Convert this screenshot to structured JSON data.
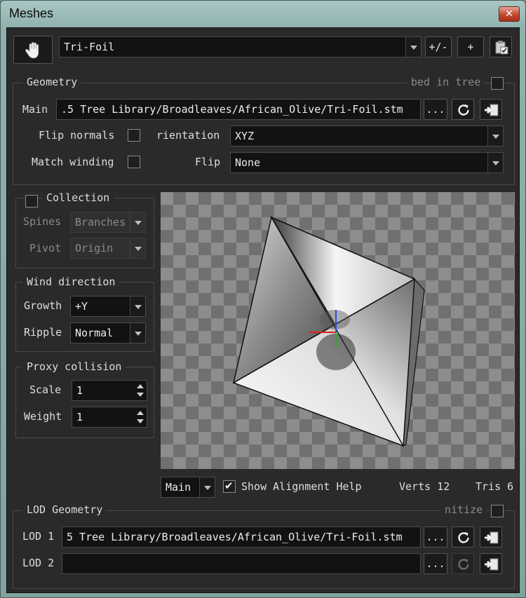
{
  "window": {
    "title": "Meshes",
    "close_icon": "close-icon"
  },
  "toolbar": {
    "mesh_name": "Tri-Foil",
    "plus_minus_label": "+/-",
    "add_label": "+"
  },
  "geometry": {
    "title": "Geometry",
    "embed_label": "bed in tree",
    "main_label": "Main",
    "main_path": ".5 Tree Library/Broadleaves/African_Olive/Tri-Foil.stm",
    "browse_label": "...",
    "flip_normals_label": "Flip normals",
    "orientation_label": "rientation",
    "orientation_value": "XYZ",
    "match_winding_label": "Match winding",
    "flip_label": "Flip",
    "flip_value": "None"
  },
  "collection": {
    "title": "Collection",
    "spines_label": "Spines",
    "spines_value": "Branches",
    "pivot_label": "Pivot",
    "pivot_value": "Origin"
  },
  "wind": {
    "title": "Wind direction",
    "growth_label": "Growth",
    "growth_value": "+Y",
    "ripple_label": "Ripple",
    "ripple_value": "Normal"
  },
  "proxy": {
    "title": "Proxy collision",
    "scale_label": "Scale",
    "scale_value": "1",
    "weight_label": "Weight",
    "weight_value": "1"
  },
  "viewport_bar": {
    "view_value": "Main",
    "show_alignment_label": "Show Alignment Help",
    "verts_label": "Verts 12",
    "tris_label": "Tris 6"
  },
  "lod": {
    "title": "LOD Geometry",
    "sanitize_label": "nitize",
    "lod1_label": "LOD 1",
    "lod1_path": "5 Tree Library/Broadleaves/African_Olive/Tri-Foil.stm",
    "lod2_label": "LOD 2",
    "lod2_path": "",
    "browse_label": "..."
  }
}
